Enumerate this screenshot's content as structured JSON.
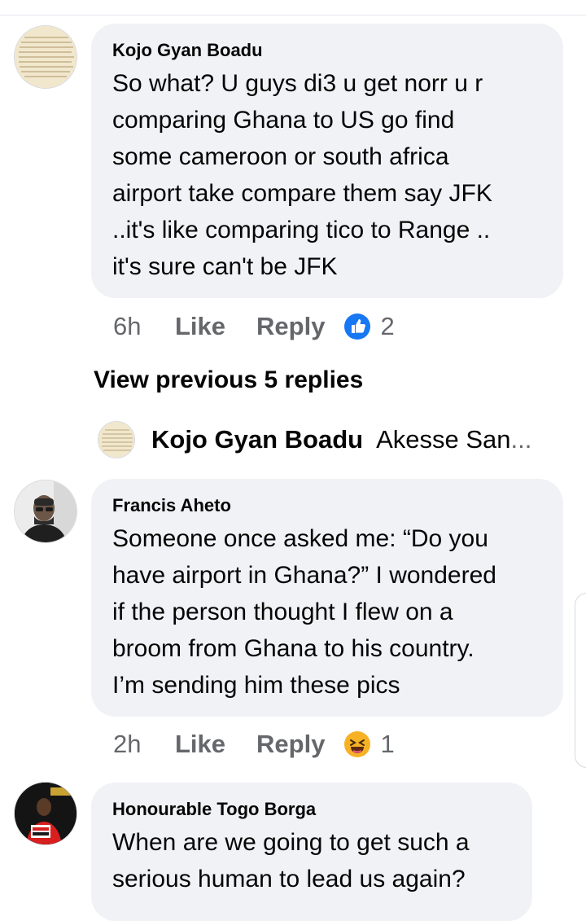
{
  "comments": [
    {
      "author": "Kojo Gyan Boadu",
      "text": "So what? U guys di3 u get norr u r\ncomparing Ghana to US go find\nsome cameroon or south africa\nairport take compare them say JFK\n..it's like comparing tico to Range ..\nit's sure can't be JFK",
      "time": "6h",
      "like_label": "Like",
      "reply_label": "Reply",
      "reaction": "like-reaction-icon",
      "reaction_count": "2"
    },
    {
      "author": "Francis Aheto",
      "text": "Someone once asked me: “Do you\nhave airport in Ghana?” I wondered\nif the person thought I flew on a\nbroom from Ghana to his country.\nI’m sending him these pics",
      "time": "2h",
      "like_label": "Like",
      "reply_label": "Reply",
      "reaction": "haha-reaction-icon",
      "reaction_count": "1"
    },
    {
      "author": "Honourable Togo Borga",
      "text": "When are we going to get such a\nserious human to lead us again?"
    }
  ],
  "view_previous_label": "View previous 5 replies",
  "collapsed_reply": {
    "author": "Kojo Gyan Boadu",
    "preview": "Akesse San",
    "ellipsis": "..."
  },
  "colors": {
    "bubble": "#f0f2f5",
    "meta_text": "#65676b",
    "like_blue": "#1877f2",
    "haha_yellow": "#f7b125"
  }
}
